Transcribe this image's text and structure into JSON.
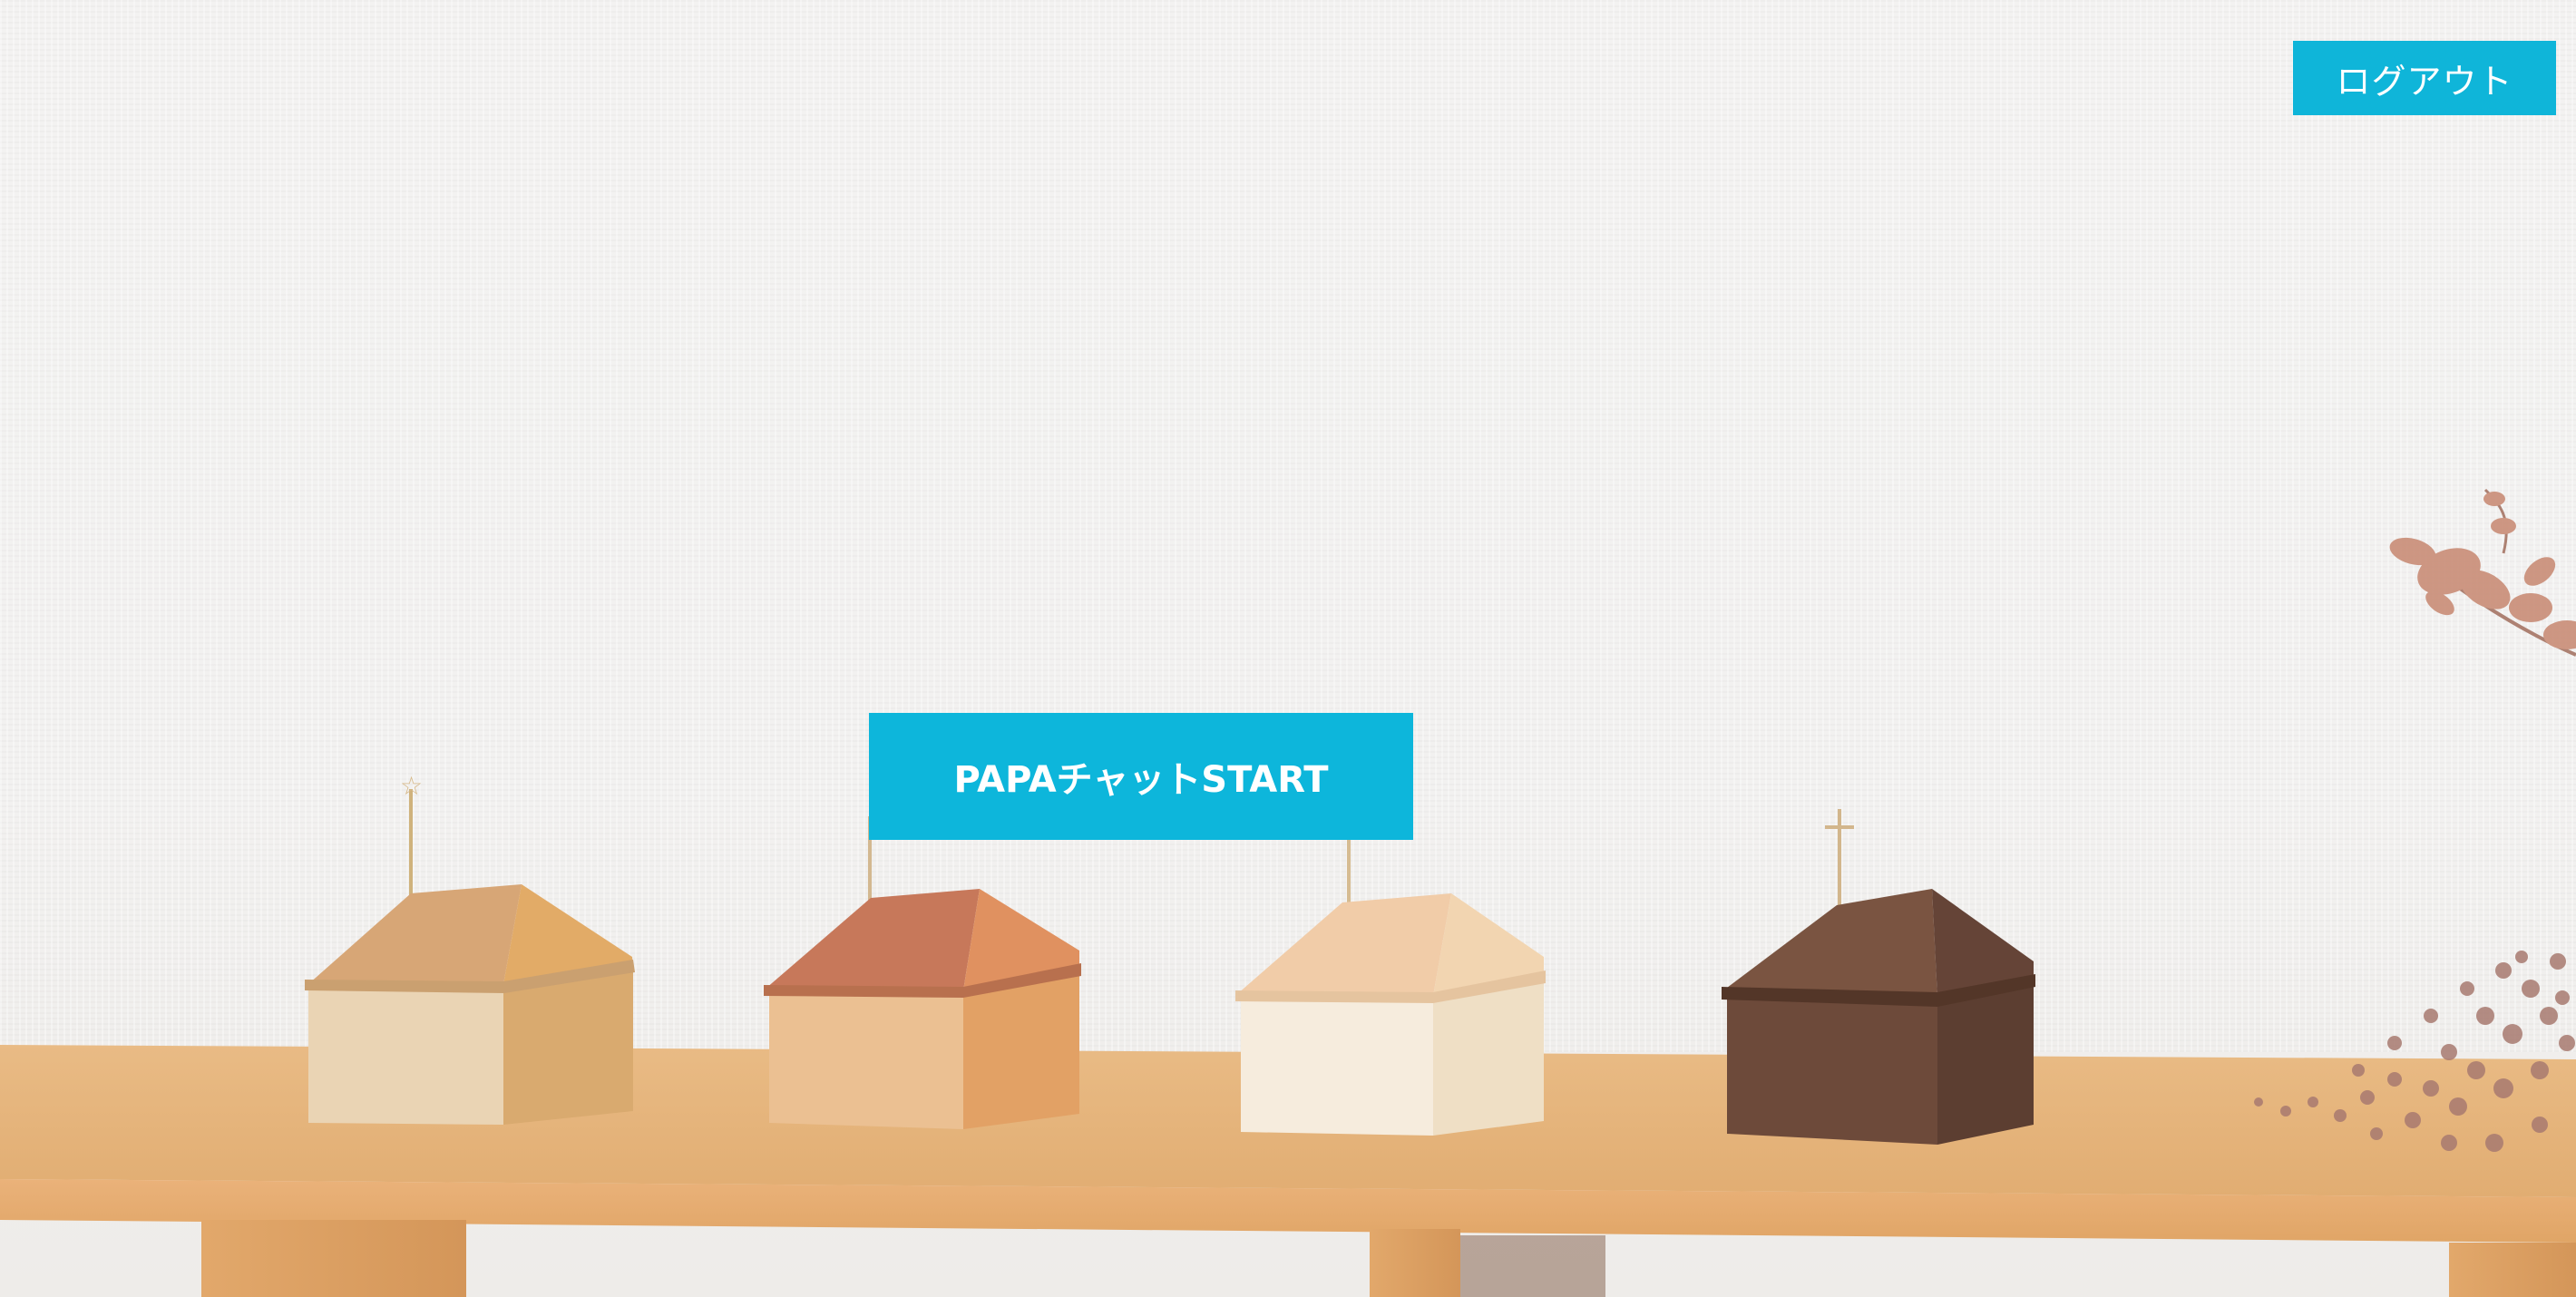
{
  "header": {
    "logout_label": "ログアウト"
  },
  "main": {
    "start_label": "PAPAチャットSTART"
  },
  "colors": {
    "accent": "#0db6db",
    "wall": "#f2f1f0",
    "shelf": "#e8b57c"
  },
  "background": {
    "description_icons": [
      "wooden-house-oak",
      "wooden-house-cherry",
      "wooden-house-maple",
      "wooden-house-walnut",
      "dried-flowers"
    ]
  }
}
